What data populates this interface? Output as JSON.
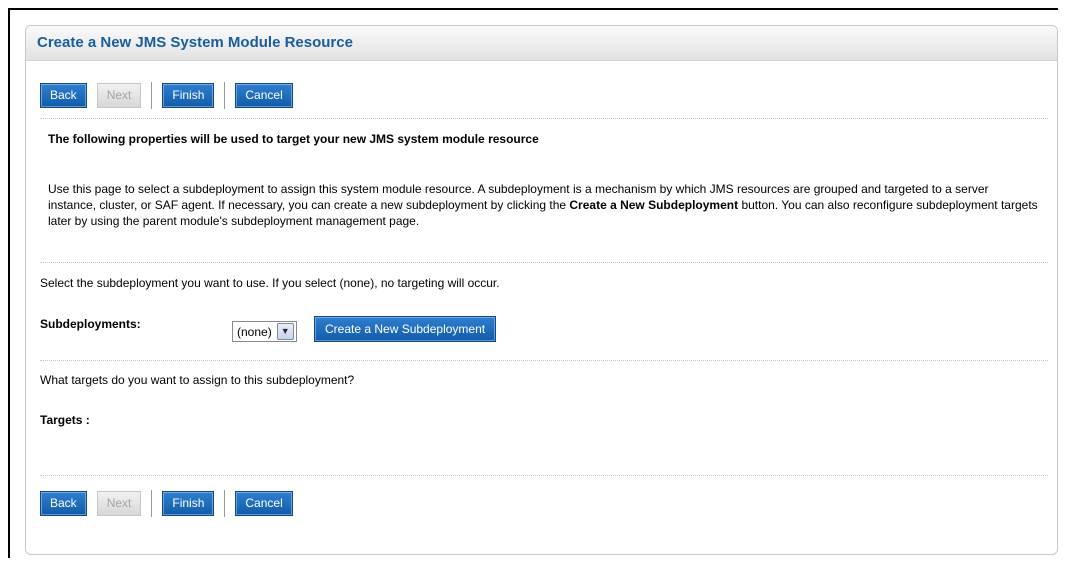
{
  "page_title": "Create a New JMS System Module Resource",
  "toolbar": {
    "back_label": "Back",
    "next_label": "Next",
    "finish_label": "Finish",
    "cancel_label": "Cancel"
  },
  "intro_heading": "The following properties will be used to target your new JMS system module resource",
  "description": {
    "part1": "Use this page to select a subdeployment to assign this system module resource. A subdeployment is a mechanism by which JMS resources are grouped and targeted to a server instance, cluster, or SAF agent. If necessary, you can create a new subdeployment by clicking the ",
    "bold": "Create a New Subdeployment",
    "part2": " button. You can also reconfigure subdeployment targets later by using the parent module's subdeployment management page."
  },
  "select_instruction": "Select the subdeployment you want to use. If you select (none), no targeting will occur.",
  "subdeployments": {
    "label": "Subdeployments:",
    "selected": "(none)",
    "create_button_label": "Create a New Subdeployment"
  },
  "targets_question": "What targets do you want to assign to this subdeployment?",
  "targets_label": "Targets :",
  "colors": {
    "title_blue": "#1b5d9c",
    "button_blue": "#1f6fbf",
    "disabled_gray": "#a5a5a5"
  }
}
